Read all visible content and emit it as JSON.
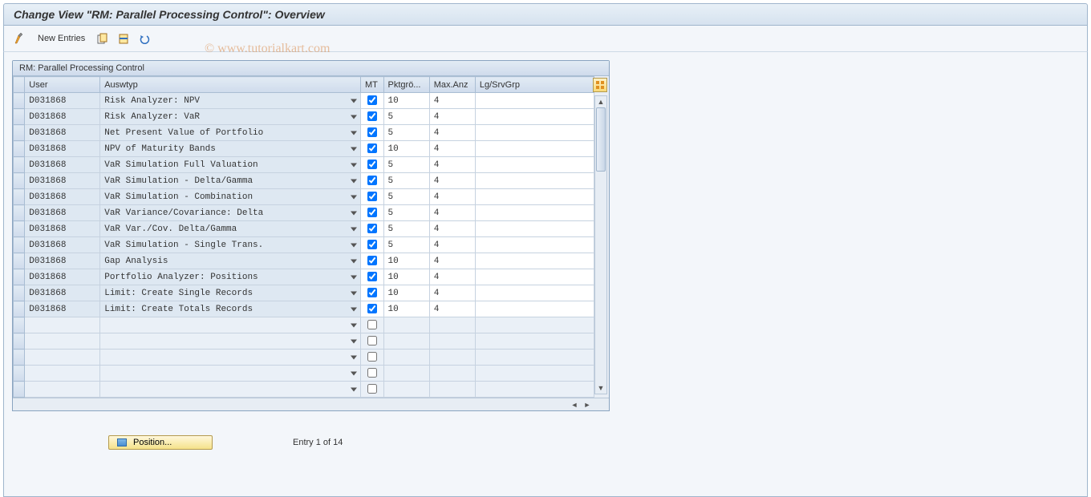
{
  "title": "Change View \"RM: Parallel Processing Control\": Overview",
  "watermark": "© www.tutorialkart.com",
  "toolbar": {
    "new_entries": "New Entries"
  },
  "panel": {
    "header": "RM: Parallel Processing Control"
  },
  "columns": {
    "user": "User",
    "auswtyp": "Auswtyp",
    "mt": "MT",
    "pkt": "Pktgrö...",
    "max": "Max.Anz",
    "lg": "Lg/SrvGrp"
  },
  "rows": [
    {
      "user": "D031868",
      "auswtyp": "Risk Analyzer: NPV",
      "mt": true,
      "pkt": "10",
      "max": "4",
      "lg": ""
    },
    {
      "user": "D031868",
      "auswtyp": "Risk Analyzer: VaR",
      "mt": true,
      "pkt": "5",
      "max": "4",
      "lg": ""
    },
    {
      "user": "D031868",
      "auswtyp": "Net Present Value of Portfolio",
      "mt": true,
      "pkt": "5",
      "max": "4",
      "lg": ""
    },
    {
      "user": "D031868",
      "auswtyp": "NPV of Maturity Bands",
      "mt": true,
      "pkt": "10",
      "max": "4",
      "lg": ""
    },
    {
      "user": "D031868",
      "auswtyp": "VaR Simulation Full Valuation",
      "mt": true,
      "pkt": "5",
      "max": "4",
      "lg": ""
    },
    {
      "user": "D031868",
      "auswtyp": "VaR Simulation - Delta/Gamma",
      "mt": true,
      "pkt": "5",
      "max": "4",
      "lg": ""
    },
    {
      "user": "D031868",
      "auswtyp": "VaR Simulation - Combination",
      "mt": true,
      "pkt": "5",
      "max": "4",
      "lg": ""
    },
    {
      "user": "D031868",
      "auswtyp": "VaR Variance/Covariance: Delta",
      "mt": true,
      "pkt": "5",
      "max": "4",
      "lg": ""
    },
    {
      "user": "D031868",
      "auswtyp": "VaR Var./Cov. Delta/Gamma",
      "mt": true,
      "pkt": "5",
      "max": "4",
      "lg": ""
    },
    {
      "user": "D031868",
      "auswtyp": "VaR Simulation - Single Trans.",
      "mt": true,
      "pkt": "5",
      "max": "4",
      "lg": ""
    },
    {
      "user": "D031868",
      "auswtyp": "Gap Analysis",
      "mt": true,
      "pkt": "10",
      "max": "4",
      "lg": ""
    },
    {
      "user": "D031868",
      "auswtyp": "Portfolio Analyzer: Positions",
      "mt": true,
      "pkt": "10",
      "max": "4",
      "lg": ""
    },
    {
      "user": "D031868",
      "auswtyp": "Limit: Create Single Records",
      "mt": true,
      "pkt": "10",
      "max": "4",
      "lg": ""
    },
    {
      "user": "D031868",
      "auswtyp": "Limit: Create Totals Records",
      "mt": true,
      "pkt": "10",
      "max": "4",
      "lg": ""
    }
  ],
  "empty_rows": 5,
  "footer": {
    "position_btn": "Position...",
    "entry_text": "Entry 1 of 14"
  }
}
